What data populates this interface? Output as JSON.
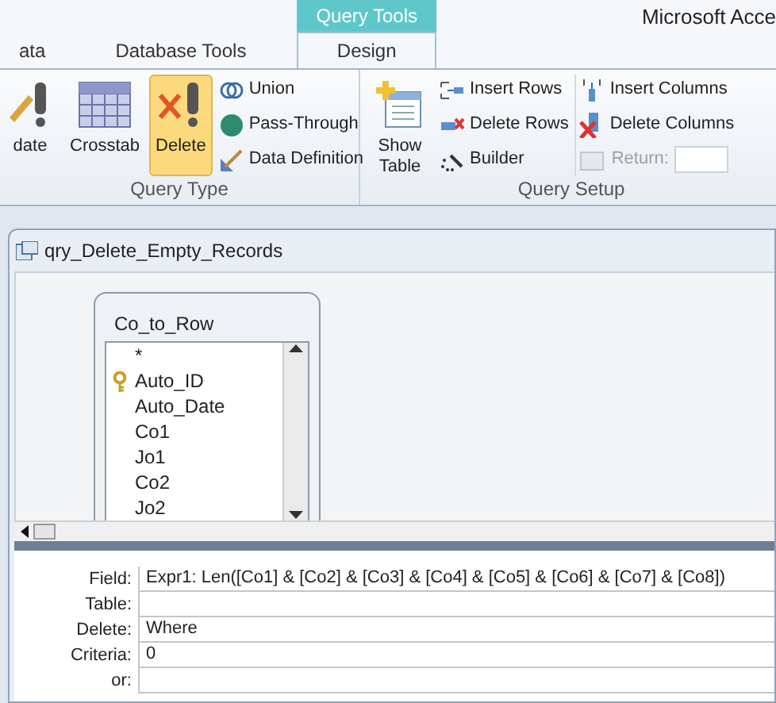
{
  "app_title": "Microsoft Acce",
  "context_tab": {
    "label": "Query Tools"
  },
  "tabs": [
    {
      "label": "ata",
      "selected": false
    },
    {
      "label": "Database Tools",
      "selected": false
    },
    {
      "label": "Design",
      "selected": true
    }
  ],
  "groups": [
    {
      "label": "Query Type",
      "large": [
        {
          "label": "date",
          "selected": false
        },
        {
          "label": "Crosstab",
          "selected": false
        },
        {
          "label": "Delete",
          "selected": true
        }
      ],
      "columns": [
        [
          {
            "kind": "button",
            "label": "Union",
            "disabled": false
          },
          {
            "kind": "button",
            "label": "Pass-Through",
            "disabled": false
          },
          {
            "kind": "button",
            "label": "Data Definition",
            "disabled": false
          }
        ]
      ]
    },
    {
      "label": "Query Setup",
      "large": [
        {
          "label": "Show Table",
          "selected": false
        }
      ],
      "columns": [
        [
          {
            "kind": "button",
            "label": "Insert Rows",
            "disabled": false
          },
          {
            "kind": "button",
            "label": "Delete Rows",
            "disabled": false
          },
          {
            "kind": "button",
            "label": "Builder",
            "disabled": false
          }
        ],
        [
          {
            "kind": "button",
            "label": "Insert Columns",
            "disabled": false
          },
          {
            "kind": "button",
            "label": "Delete Columns",
            "disabled": false
          },
          {
            "kind": "field",
            "label": "Return:",
            "disabled": true
          }
        ]
      ]
    }
  ],
  "query_window": {
    "title": "qry_Delete_Empty_Records",
    "table": {
      "title": "Co_to_Row",
      "fields": [
        {
          "label": "*",
          "key": false
        },
        {
          "label": "Auto_ID",
          "key": true
        },
        {
          "label": "Auto_Date",
          "key": false
        },
        {
          "label": "Co1",
          "key": false
        },
        {
          "label": "Jo1",
          "key": false
        },
        {
          "label": "Co2",
          "key": false
        },
        {
          "label": "Jo2",
          "key": false
        }
      ]
    },
    "grid": [
      {
        "label": "Field:",
        "value": "Expr1: Len([Co1] & [Co2] & [Co3] & [Co4] & [Co5] & [Co6] & [Co7] & [Co8])"
      },
      {
        "label": "Table:"
      },
      {
        "label": "Delete:",
        "value": "Where"
      },
      {
        "label": "Criteria:",
        "value": "0"
      },
      {
        "label": "or:"
      }
    ]
  }
}
